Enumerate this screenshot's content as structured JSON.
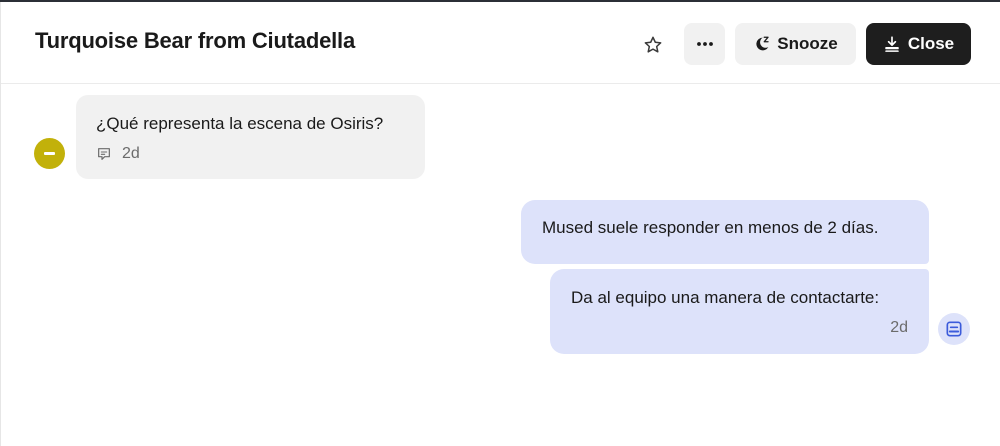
{
  "conversation": {
    "title": "Turquoise Bear from Ciutadella"
  },
  "toolbar": {
    "star_icon": "star-outline-icon",
    "more_icon": "ellipsis-icon",
    "snooze_label": "Snooze",
    "snooze_icon": "moon-z-icon",
    "close_label": "Close",
    "close_icon": "download-tray-icon"
  },
  "messages": [
    {
      "direction": "incoming",
      "text": "¿Qué representa la escena de Osiris?",
      "channel_icon": "chat-bubble-icon",
      "time": "2d"
    },
    {
      "direction": "outgoing",
      "text": "Mused suele responder en menos de 2 días."
    },
    {
      "direction": "outgoing",
      "text": "Da al equipo una manera de contactarte:",
      "time": "2d"
    }
  ],
  "colors": {
    "avatar": "#c2b10a",
    "outgoing_bubble": "#dde2fa",
    "incoming_bubble": "#f1f1f1",
    "close_button": "#1e1e1e",
    "agent_badge_icon": "#3b5bdb"
  }
}
